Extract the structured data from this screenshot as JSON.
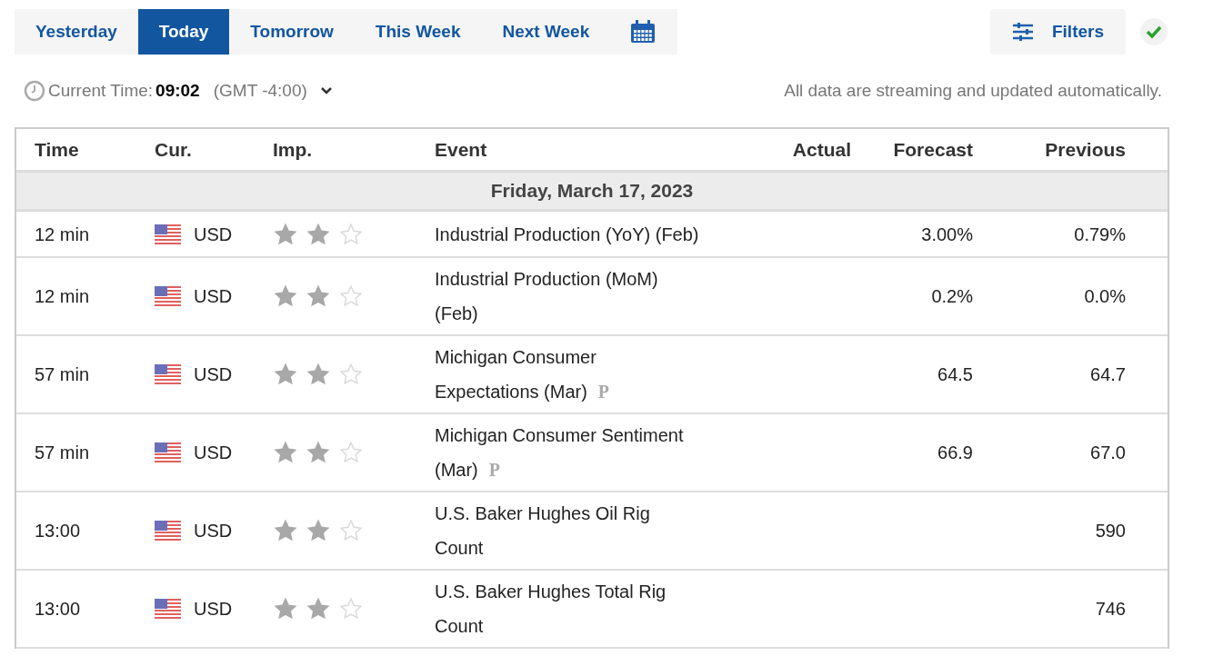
{
  "tabs": [
    {
      "label": "Yesterday",
      "selected": false
    },
    {
      "label": "Today",
      "selected": true
    },
    {
      "label": "Tomorrow",
      "selected": false
    },
    {
      "label": "This Week",
      "selected": false
    },
    {
      "label": "Next Week",
      "selected": false
    }
  ],
  "filters_button": "Filters",
  "current_time": {
    "label": "Current Time:",
    "value": "09:02",
    "zone": "(GMT -4:00)"
  },
  "streaming_note": "All data are streaming and updated automatically.",
  "table": {
    "columns": [
      "Time",
      "Cur.",
      "Imp.",
      "Event",
      "Actual",
      "Forecast",
      "Previous"
    ],
    "date_header": "Friday, March 17, 2023",
    "rows": [
      {
        "time": "12 min",
        "currency": "USD",
        "stars": 2,
        "event_lines": [
          "Industrial Production (YoY) (Feb)"
        ],
        "preliminary": "",
        "actual": "",
        "forecast": "3.00%",
        "previous": "0.79%"
      },
      {
        "time": "12 min",
        "currency": "USD",
        "stars": 2,
        "event_lines": [
          "Industrial Production (MoM)",
          "(Feb)"
        ],
        "preliminary": "",
        "actual": "",
        "forecast": "0.2%",
        "previous": "0.0%"
      },
      {
        "time": "57 min",
        "currency": "USD",
        "stars": 2,
        "event_lines": [
          "Michigan Consumer",
          "Expectations (Mar)"
        ],
        "preliminary": "P",
        "actual": "",
        "forecast": "64.5",
        "previous": "64.7"
      },
      {
        "time": "57 min",
        "currency": "USD",
        "stars": 2,
        "event_lines": [
          "Michigan Consumer Sentiment",
          "(Mar)"
        ],
        "preliminary": "P",
        "actual": "",
        "forecast": "66.9",
        "previous": "67.0"
      },
      {
        "time": "13:00",
        "currency": "USD",
        "stars": 2,
        "event_lines": [
          "U.S. Baker Hughes Oil Rig",
          "Count"
        ],
        "preliminary": "",
        "actual": "",
        "forecast": "",
        "previous": "590"
      },
      {
        "time": "13:00",
        "currency": "USD",
        "stars": 2,
        "event_lines": [
          "U.S. Baker Hughes Total Rig",
          "Count"
        ],
        "preliminary": "",
        "actual": "",
        "forecast": "",
        "previous": "746"
      }
    ]
  }
}
